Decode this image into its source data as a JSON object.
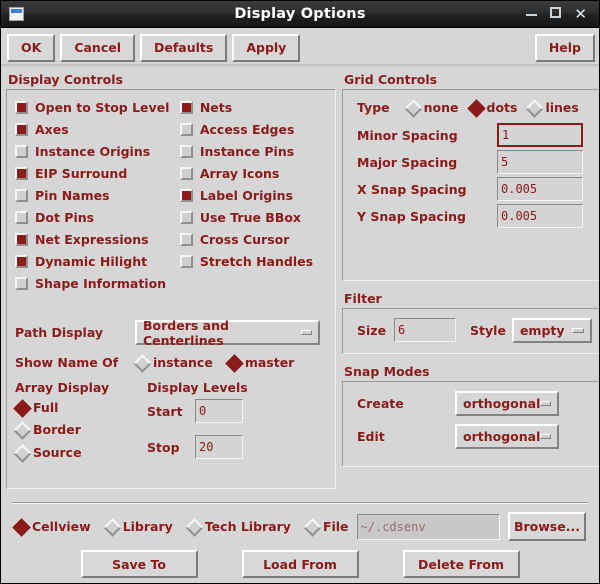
{
  "window": {
    "title": "Display Options",
    "icon": "window-icon",
    "controls": {
      "minimize": "_",
      "maximize": "□",
      "close": "✕"
    }
  },
  "toolbar": {
    "ok": "OK",
    "cancel": "Cancel",
    "defaults": "Defaults",
    "apply": "Apply",
    "help": "Help"
  },
  "display_controls": {
    "title": "Display Controls",
    "checkboxes_left": [
      {
        "label": "Open to Stop Level",
        "checked": true
      },
      {
        "label": "Axes",
        "checked": true
      },
      {
        "label": "Instance Origins",
        "checked": false
      },
      {
        "label": "EIP Surround",
        "checked": true
      },
      {
        "label": "Pin Names",
        "checked": false
      },
      {
        "label": "Dot Pins",
        "checked": false
      },
      {
        "label": "Net Expressions",
        "checked": true
      },
      {
        "label": "Dynamic Hilight",
        "checked": true
      },
      {
        "label": "Shape Information",
        "checked": false
      }
    ],
    "checkboxes_right": [
      {
        "label": "Nets",
        "checked": true
      },
      {
        "label": "Access Edges",
        "checked": false
      },
      {
        "label": "Instance Pins",
        "checked": false
      },
      {
        "label": "Array Icons",
        "checked": false
      },
      {
        "label": "Label Origins",
        "checked": true
      },
      {
        "label": "Use True BBox",
        "checked": false
      },
      {
        "label": "Cross Cursor",
        "checked": false
      },
      {
        "label": "Stretch Handles",
        "checked": false
      }
    ],
    "path_display": {
      "label": "Path Display",
      "value": "Borders and Centerlines"
    },
    "show_name_of": {
      "label": "Show Name Of",
      "options": [
        {
          "label": "instance",
          "selected": false
        },
        {
          "label": "master",
          "selected": true
        }
      ]
    },
    "array_display": {
      "label": "Array Display",
      "options": [
        {
          "label": "Full",
          "selected": true
        },
        {
          "label": "Border",
          "selected": false
        },
        {
          "label": "Source",
          "selected": false
        }
      ]
    },
    "display_levels": {
      "label": "Display Levels",
      "start_label": "Start",
      "start_value": "0",
      "stop_label": "Stop",
      "stop_value": "20"
    }
  },
  "grid_controls": {
    "title": "Grid Controls",
    "type_label": "Type",
    "type_options": [
      {
        "label": "none",
        "selected": false
      },
      {
        "label": "dots",
        "selected": true
      },
      {
        "label": "lines",
        "selected": false
      }
    ],
    "fields": [
      {
        "label": "Minor Spacing",
        "value": "1",
        "focused": true
      },
      {
        "label": "Major Spacing",
        "value": "5",
        "focused": false
      },
      {
        "label": "X Snap Spacing",
        "value": "0.005",
        "focused": false
      },
      {
        "label": "Y Snap Spacing",
        "value": "0.005",
        "focused": false
      }
    ]
  },
  "filter": {
    "title": "Filter",
    "size_label": "Size",
    "size_value": "6",
    "style_label": "Style",
    "style_value": "empty"
  },
  "snap_modes": {
    "title": "Snap Modes",
    "create_label": "Create",
    "create_value": "orthogonal",
    "edit_label": "Edit",
    "edit_value": "orthogonal"
  },
  "bottom": {
    "scope_options": [
      {
        "label": "Cellview",
        "selected": true
      },
      {
        "label": "Library",
        "selected": false
      },
      {
        "label": "Tech Library",
        "selected": false
      },
      {
        "label": "File",
        "selected": false
      }
    ],
    "file_value": "~/.cdsenv",
    "browse_label": "Browse...",
    "save_to": "Save To",
    "load_from": "Load From",
    "delete_from": "Delete From"
  },
  "colors": {
    "accent": "#8b1a1a",
    "face": "#d6d6d6",
    "titlebar": "#2b2d2f"
  }
}
